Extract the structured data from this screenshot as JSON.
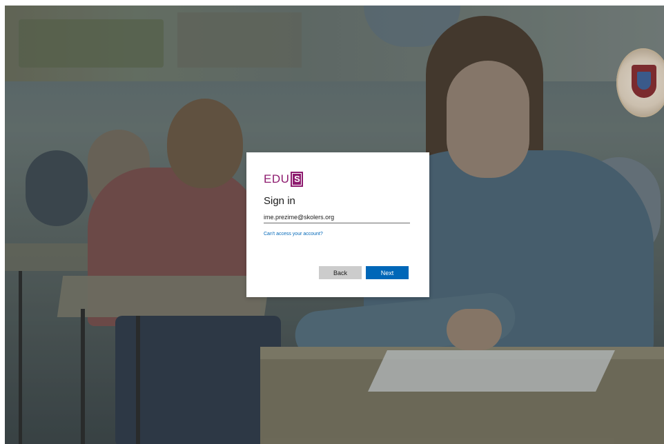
{
  "background": {
    "description_icon": "classroom-photo"
  },
  "emblem": {
    "icon": "coat-of-arms-icon"
  },
  "signin": {
    "logo_text": "EDU",
    "logo_badge": "S",
    "title": "Sign in",
    "email_value": "ime.prezime@skolers.org",
    "help_link": "Can't access your account?",
    "back_label": "Back",
    "next_label": "Next"
  },
  "colors": {
    "brand": "#8e1b6f",
    "primary_button": "#0067b8",
    "secondary_button": "#cccccc",
    "link": "#0067b8"
  }
}
